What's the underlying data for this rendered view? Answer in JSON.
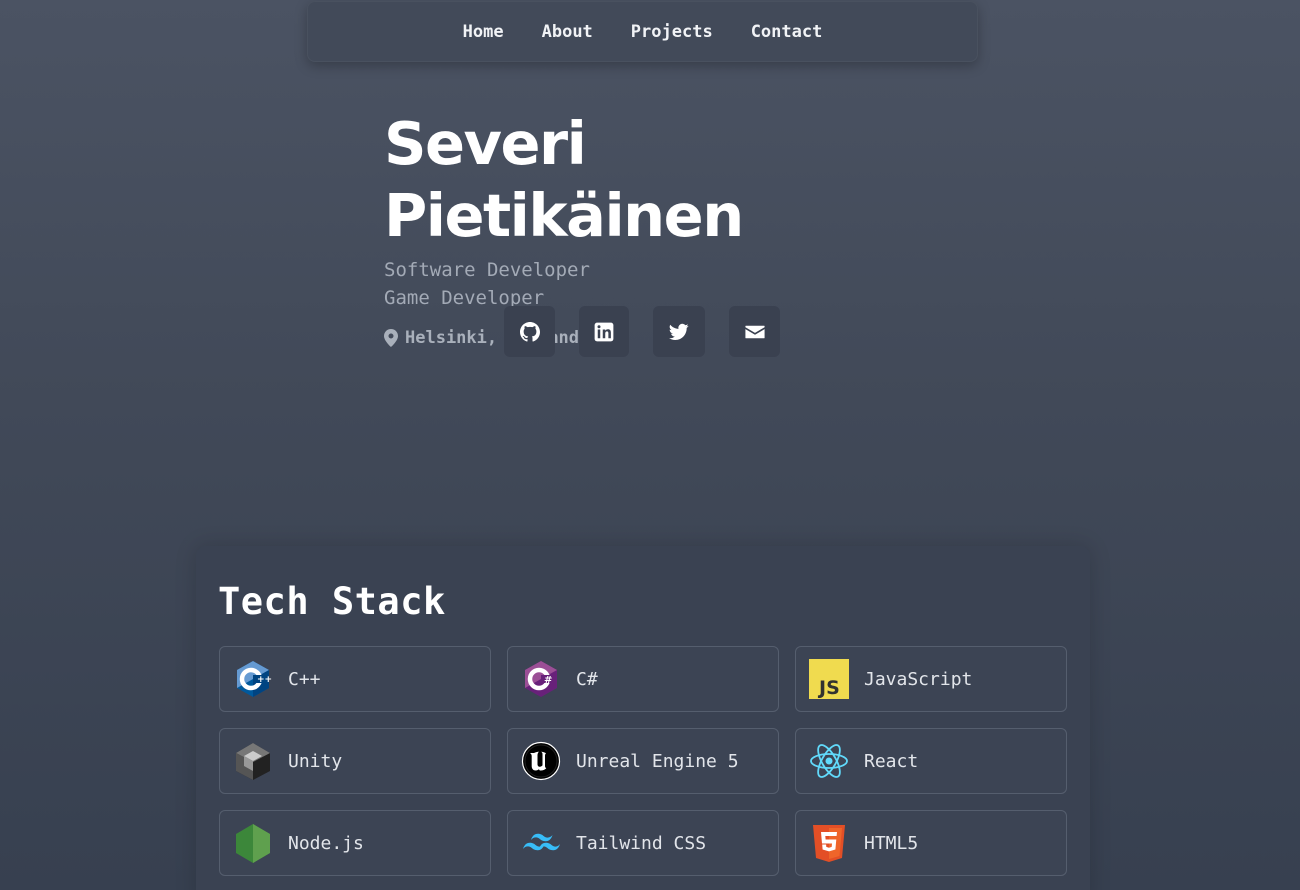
{
  "nav": {
    "items": [
      "Home",
      "About",
      "Projects",
      "Contact"
    ]
  },
  "hero": {
    "name": "Severi Pietikäinen",
    "roles": [
      "Software Developer",
      "Game Developer"
    ],
    "location": "Helsinki, Finland",
    "location_icon": "map-pin-icon"
  },
  "socials": [
    {
      "icon": "github-icon"
    },
    {
      "icon": "linkedin-icon"
    },
    {
      "icon": "twitter-icon"
    },
    {
      "icon": "envelope-icon"
    }
  ],
  "tech": {
    "title": "Tech Stack",
    "items": [
      {
        "label": "C++",
        "icon": "cplusplus-icon"
      },
      {
        "label": "C#",
        "icon": "csharp-icon"
      },
      {
        "label": "JavaScript",
        "icon": "javascript-icon"
      },
      {
        "label": "Unity",
        "icon": "unity-icon"
      },
      {
        "label": "Unreal Engine 5",
        "icon": "unreal-engine-icon"
      },
      {
        "label": "React",
        "icon": "react-icon"
      },
      {
        "label": "Node.js",
        "icon": "nodejs-icon"
      },
      {
        "label": "Tailwind CSS",
        "icon": "tailwind-icon"
      },
      {
        "label": "HTML5",
        "icon": "html5-icon"
      }
    ]
  },
  "colors": {
    "background_top": "#4b5363",
    "background_bottom": "#374050",
    "card_bg": "#3c4454",
    "card_border": "#555e6e",
    "subtitle": "#a3aab6"
  }
}
